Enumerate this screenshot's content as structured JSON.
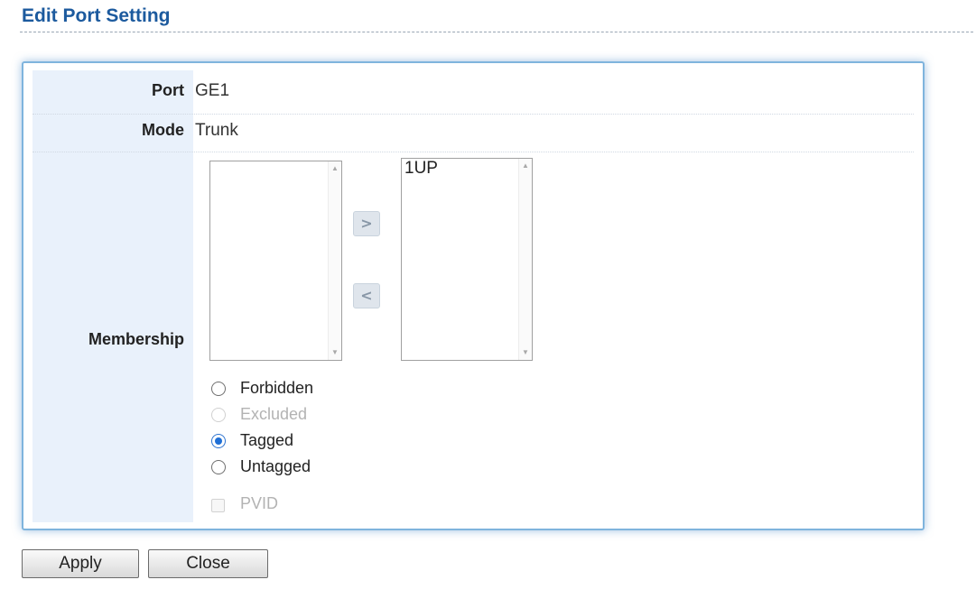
{
  "page": {
    "title": "Edit Port Setting"
  },
  "form": {
    "port": {
      "label": "Port",
      "value": "GE1"
    },
    "mode": {
      "label": "Mode",
      "value": "Trunk"
    },
    "membership": {
      "label": "Membership",
      "available_list": [],
      "selected_list": [
        "1UP"
      ],
      "move_right_icon": "chevron-right-icon",
      "move_left_icon": "chevron-left-icon",
      "options": [
        {
          "label": "Forbidden",
          "checked": false,
          "disabled": false
        },
        {
          "label": "Excluded",
          "checked": false,
          "disabled": true
        },
        {
          "label": "Tagged",
          "checked": true,
          "disabled": false
        },
        {
          "label": "Untagged",
          "checked": false,
          "disabled": false
        }
      ],
      "pvid": {
        "label": "PVID",
        "checked": false,
        "disabled": true
      }
    }
  },
  "buttons": {
    "apply": "Apply",
    "close": "Close"
  },
  "colors": {
    "title": "#1c5a9e",
    "label_bg": "#e9f1fb",
    "panel_border": "#7fb4dd",
    "radio_selected": "#1f6fd6"
  }
}
